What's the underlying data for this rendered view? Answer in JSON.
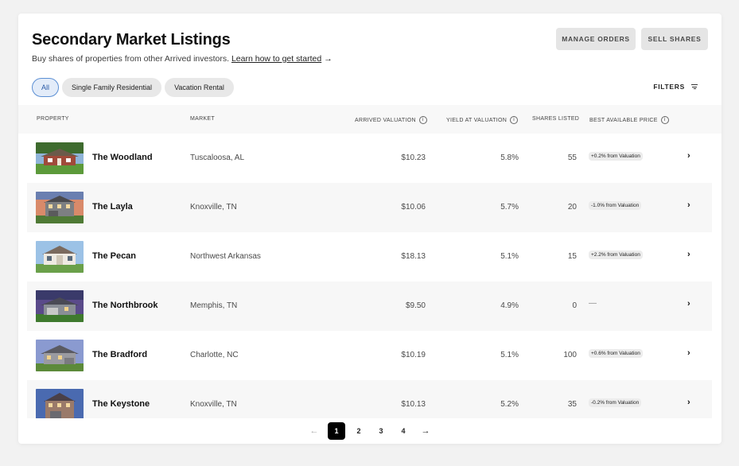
{
  "header": {
    "title": "Secondary Market Listings",
    "subtitle": "Buy shares of properties from other Arrived investors.",
    "learn_link": "Learn how to get started",
    "learn_arrow": "→",
    "manage_orders": "MANAGE ORDERS",
    "sell_shares": "SELL SHARES"
  },
  "filters": {
    "chips": [
      "All",
      "Single Family Residential",
      "Vacation Rental"
    ],
    "active_chip": "All",
    "filters_label": "FILTERS",
    "filters_icon": "filter-lines-icon"
  },
  "table": {
    "columns": {
      "property": "PROPERTY",
      "market": "MARKET",
      "valuation": "ARRIVED VALUATION",
      "yield": "YIELD AT VALUATION",
      "shares": "SHARES LISTED",
      "best_price": "BEST AVAILABLE PRICE"
    },
    "rows": [
      {
        "name": "The Woodland",
        "market": "Tuscaloosa, AL",
        "valuation": "$10.23",
        "yield": "5.8%",
        "shares": "55",
        "best_price": "+0.2% from Valuation"
      },
      {
        "name": "The Layla",
        "market": "Knoxville, TN",
        "valuation": "$10.06",
        "yield": "5.7%",
        "shares": "20",
        "best_price": "-1.0% from Valuation"
      },
      {
        "name": "The Pecan",
        "market": "Northwest Arkansas",
        "valuation": "$18.13",
        "yield": "5.1%",
        "shares": "15",
        "best_price": "+2.2% from Valuation"
      },
      {
        "name": "The Northbrook",
        "market": "Memphis, TN",
        "valuation": "$9.50",
        "yield": "4.9%",
        "shares": "0",
        "best_price": "—"
      },
      {
        "name": "The Bradford",
        "market": "Charlotte, NC",
        "valuation": "$10.19",
        "yield": "5.1%",
        "shares": "100",
        "best_price": "+0.6% from Valuation"
      },
      {
        "name": "The Keystone",
        "market": "Knoxville, TN",
        "valuation": "$10.13",
        "yield": "5.2%",
        "shares": "35",
        "best_price": "-0.2% from Valuation"
      }
    ]
  },
  "pagination": {
    "prev": "←",
    "pages": [
      "1",
      "2",
      "3",
      "4"
    ],
    "current": "1",
    "next": "→"
  },
  "colors": {
    "active_chip_bg": "#e3ecf9",
    "active_chip_border": "#5b8fd4",
    "current_page_bg": "#000000"
  }
}
